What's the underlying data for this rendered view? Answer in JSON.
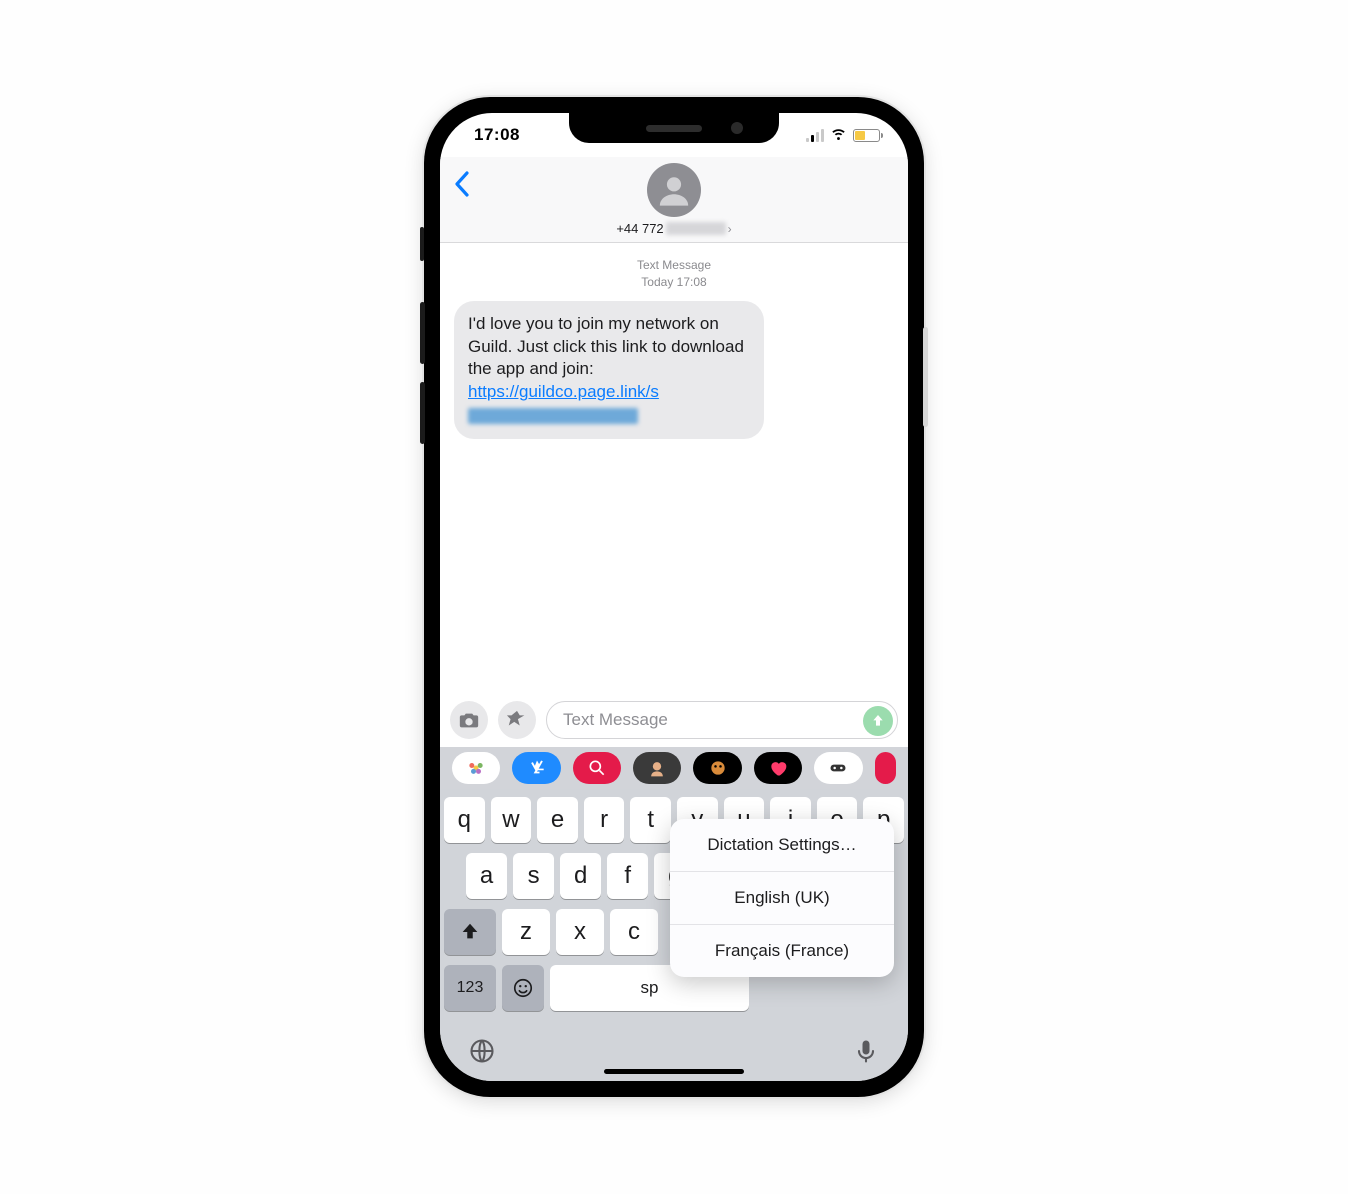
{
  "status": {
    "time": "17:08"
  },
  "header": {
    "contact_prefix": "+44 772"
  },
  "thread": {
    "meta_label": "Text Message",
    "meta_time": "Today 17:08",
    "message_text": "I'd love you to join my network on Guild. Just click this link to download the app and join: ",
    "link_part1": "https://guildco.page.link/",
    "link_part2_prefix": "s"
  },
  "compose": {
    "placeholder": "Text Message"
  },
  "keyboard": {
    "row1": [
      "q",
      "w",
      "e",
      "r",
      "t",
      "y",
      "u",
      "i",
      "o",
      "p"
    ],
    "row2": [
      "a",
      "s",
      "d",
      "f",
      "g"
    ],
    "row3": [
      "z",
      "x",
      "c"
    ],
    "num_key": "123",
    "space_key_visible": "sp"
  },
  "popup": {
    "settings": "Dictation Settings…",
    "lang1": "English (UK)",
    "lang2": "Français (France)"
  }
}
